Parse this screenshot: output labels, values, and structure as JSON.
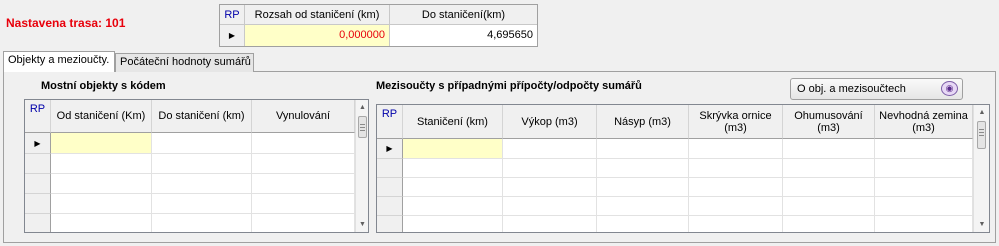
{
  "route": {
    "label": "Nastavena trasa: 101"
  },
  "range_grid": {
    "columns": [
      "RP",
      "Rozsah od staničení (km)",
      "Do staničení(km)"
    ],
    "row": {
      "from": "0,000000",
      "to": "4,695650"
    }
  },
  "tabs": [
    {
      "label": "Objekty a mezioučty.",
      "active": true
    },
    {
      "label": "Počáteční hodnoty sumářů",
      "active": false
    }
  ],
  "bridges": {
    "title": "Mostní objekty s kódem",
    "columns": [
      "RP",
      "Od staničení (Km)",
      "Do staničení (km)",
      "Vynulování"
    ]
  },
  "subtotals": {
    "title": "Mezisoučty s případnými přípočty/odpočty sumářů",
    "button_label": "O obj. a mezisoučtech",
    "columns": [
      "RP",
      "Staničení (km)",
      "Výkop (m3)",
      "Násyp (m3)",
      "Skrývka ornice (m3)",
      "Ohumusování (m3)",
      "Nevhodná zemina (m3)"
    ]
  },
  "colors": {
    "route_label": "#e8000b",
    "red_value": "#e8000b",
    "new_row": "#ffffc8",
    "rp_header": "#0000aa"
  },
  "icons": {
    "row_indicator": "triangle-right",
    "info_button": "help-icon"
  }
}
